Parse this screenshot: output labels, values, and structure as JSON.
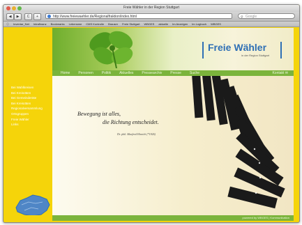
{
  "window": {
    "title": "Freie Wähler in der Region Stuttgart"
  },
  "toolbar": {
    "back": "◀",
    "forward": "▶",
    "reload": "C",
    "add": "+",
    "url": "http://www.freiewaehler.de/Regionalfraktion/index.html",
    "search_placeholder": "Google"
  },
  "bookmarks": [
    "ⓘ",
    "Inventar_Net",
    "Intrafinanz",
    "Bookmarks",
    "Lebensme",
    "CMS Kontrolle",
    "Brauser",
    "Freie Stuttgart",
    "WBGES",
    "aktuelle",
    "Im Anzeigen",
    "Im Logbuch",
    "WBGES"
  ],
  "logo": {
    "name": "Freie Wähler",
    "subtitle": "in der Region Stuttgart"
  },
  "nav": {
    "items": [
      "Home",
      "Personen",
      "Politik",
      "Aktuelles",
      "Pressearchiv",
      "Presse",
      "Suche"
    ],
    "right": "Kontakt ✉"
  },
  "sidebar": {
    "links": [
      "Bei Wahlkreisen",
      "Bei Kreisräten",
      "Bei Gemeinderäte",
      "Bei Kreisräten",
      "Regionalversammlung",
      "Ortsgruppen",
      "Freie Wähler",
      "Links"
    ]
  },
  "content": {
    "quote_line1": "Bewegung ist alles,",
    "quote_line2": "die Richtung entscheidet.",
    "quote_author": "Dr. phil. Manfred Hinrich (*1926)"
  },
  "footer": {
    "text": "powered by WBGES | Kommunikation"
  },
  "colors": {
    "yellow": "#f5d40a",
    "green": "#7bb43c",
    "blue": "#2e6fb5"
  }
}
